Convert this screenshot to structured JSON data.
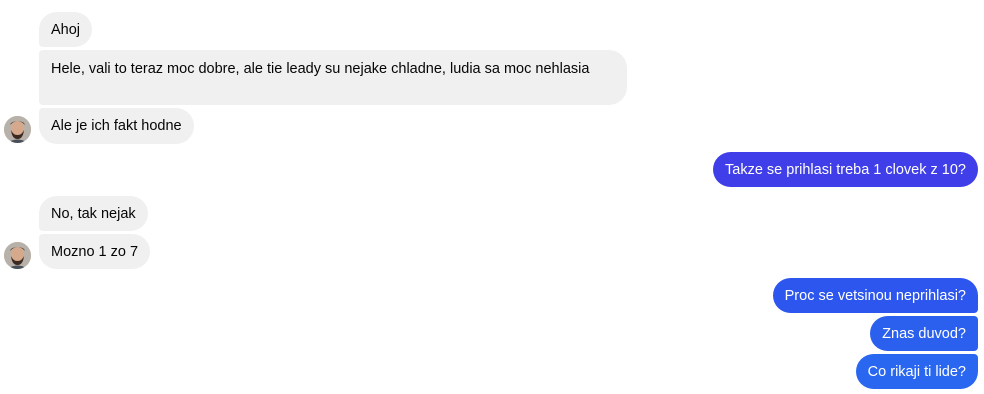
{
  "messages": [
    {
      "sender": "them",
      "text": "Ahoj"
    },
    {
      "sender": "them",
      "text": "Hele, vali to teraz moc dobre, ale tie leady su nejake chladne, ludia sa moc nehlasia"
    },
    {
      "sender": "them",
      "text": "Ale je ich fakt hodne"
    },
    {
      "sender": "me",
      "text": "Takze se prihlasi treba 1 clovek z 10?"
    },
    {
      "sender": "them",
      "text": "No, tak nejak"
    },
    {
      "sender": "them",
      "text": "Mozno 1 zo 7"
    },
    {
      "sender": "me",
      "text": "Proc se vetsinou neprihlasi?"
    },
    {
      "sender": "me",
      "text": "Znas duvod?"
    },
    {
      "sender": "me",
      "text": "Co rikaji ti lide?"
    }
  ],
  "colors": {
    "incoming_bubble": "#f0f0f0",
    "outgoing_bubble_top": "#3f3ee8",
    "outgoing_bubble_bottom": "#2a67f0"
  },
  "icons": [
    "contact-avatar"
  ]
}
